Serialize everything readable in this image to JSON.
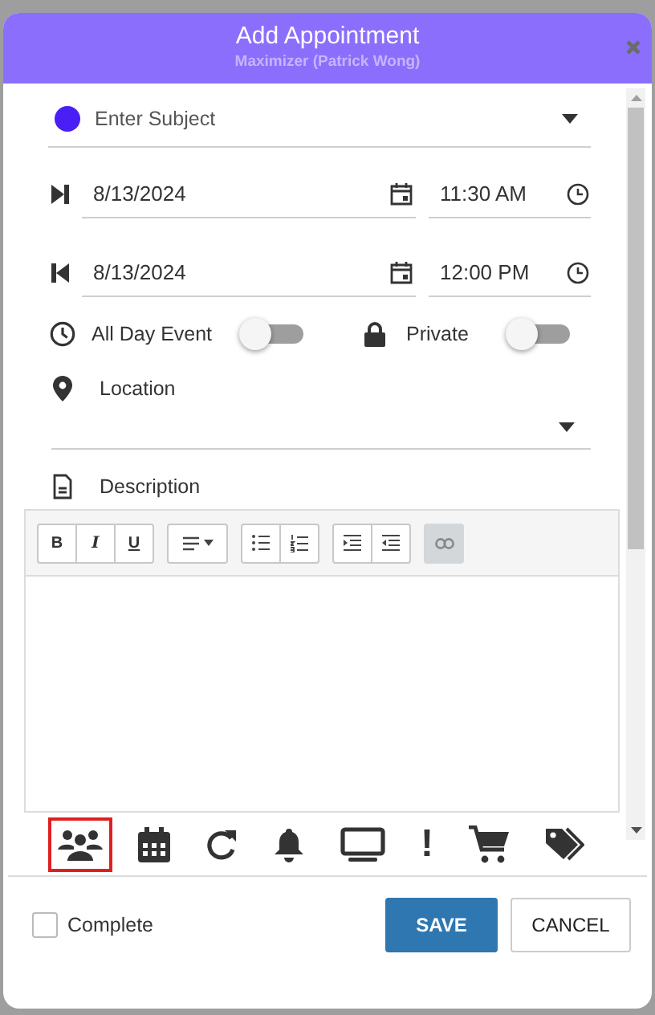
{
  "dialog": {
    "title": "Add Appointment",
    "subtitle": "Maximizer (Patrick Wong)"
  },
  "subject": {
    "placeholder": "Enter Subject",
    "color": "#4a1ff5"
  },
  "start": {
    "date": "8/13/2024",
    "time": "11:30 AM"
  },
  "end": {
    "date": "8/13/2024",
    "time": "12:00 PM"
  },
  "toggles": [
    {
      "kind": "clock",
      "label": "All Day Event",
      "on": false
    },
    {
      "kind": "lock",
      "label": "Private",
      "on": false
    }
  ],
  "location": {
    "label": "Location"
  },
  "description": {
    "label": "Description"
  },
  "editor_toolbar": [
    {
      "tools": [
        {
          "kind": "bold",
          "text": "B"
        },
        {
          "kind": "italic",
          "text": "I"
        },
        {
          "kind": "underline",
          "text": "U"
        }
      ]
    },
    {
      "tools": [
        {
          "kind": "align"
        }
      ]
    },
    {
      "tools": [
        {
          "kind": "bullets"
        },
        {
          "kind": "numbers"
        }
      ]
    },
    {
      "tools": [
        {
          "kind": "indent"
        },
        {
          "kind": "outdent"
        }
      ]
    },
    {
      "tools": [
        {
          "kind": "link",
          "disabled": true
        }
      ]
    }
  ],
  "tabs": [
    {
      "kind": "people",
      "selected": true
    },
    {
      "kind": "calendar",
      "selected": false
    },
    {
      "kind": "repeat",
      "selected": false
    },
    {
      "kind": "bell",
      "selected": false
    },
    {
      "kind": "monitor",
      "selected": false
    },
    {
      "kind": "exclamation",
      "text": "!",
      "selected": false
    },
    {
      "kind": "cart",
      "selected": false
    },
    {
      "kind": "tags",
      "selected": false
    }
  ],
  "complete": {
    "label": "Complete",
    "checked": false
  },
  "buttons": [
    {
      "kind": "primary",
      "label": "SAVE"
    },
    {
      "kind": "secondary",
      "label": "CANCEL"
    }
  ]
}
